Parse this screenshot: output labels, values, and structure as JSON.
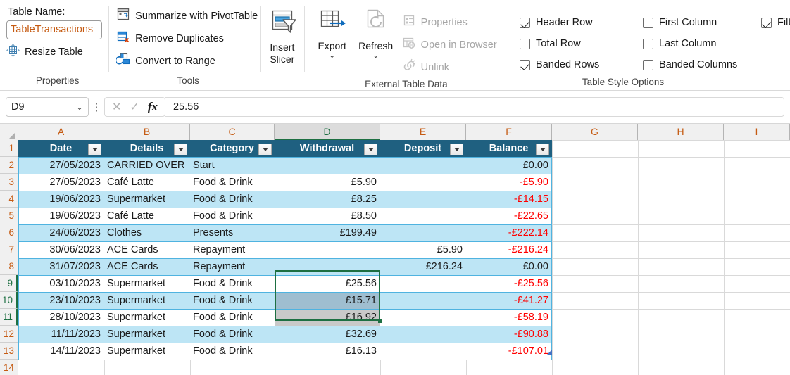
{
  "ribbon": {
    "properties": {
      "group_label": "Properties",
      "table_name_label": "Table Name:",
      "table_name_value": "TableTransactions",
      "resize_table": "Resize Table"
    },
    "tools": {
      "group_label": "Tools",
      "summarize": "Summarize with PivotTable",
      "remove_duplicates": "Remove Duplicates",
      "convert_to_range": "Convert to Range"
    },
    "slicer": {
      "insert_slicer_line1": "Insert",
      "insert_slicer_line2": "Slicer"
    },
    "external": {
      "group_label": "External Table Data",
      "export": "Export",
      "refresh": "Refresh",
      "properties": "Properties",
      "open_in_browser": "Open in Browser",
      "unlink": "Unlink",
      "chevron": "⌄"
    },
    "table_style_options": {
      "group_label": "Table Style Options",
      "items": [
        {
          "label": "Header Row",
          "checked": true
        },
        {
          "label": "Total Row",
          "checked": false
        },
        {
          "label": "Banded Rows",
          "checked": true
        },
        {
          "label": "First Column",
          "checked": false
        },
        {
          "label": "Last Column",
          "checked": false
        },
        {
          "label": "Banded Columns",
          "checked": false
        },
        {
          "label": "Filter Button",
          "checked": true
        }
      ]
    }
  },
  "formula_bar": {
    "name_box_value": "D9",
    "name_box_chevron": "⌄",
    "more_dots": "⋮",
    "cancel_icon": "✕",
    "confirm_icon": "✓",
    "fx_label": "fx",
    "formula_value": "25.56"
  },
  "grid": {
    "columns": [
      "A",
      "B",
      "C",
      "D",
      "E",
      "F",
      "G",
      "H",
      "I"
    ],
    "active_column": "D",
    "rows": [
      "1",
      "2",
      "3",
      "4",
      "5",
      "6",
      "7",
      "8",
      "9",
      "10",
      "11",
      "12",
      "13",
      "14"
    ],
    "active_rows": [
      "9",
      "10",
      "11"
    ],
    "active_cell": "D9",
    "selection_range": "D9:D11",
    "header_row": [
      "Date",
      "Details",
      "Category",
      "Withdrawal",
      "Deposit",
      "Balance"
    ],
    "data": [
      {
        "date": "27/05/2023",
        "details": "CARRIED OVER",
        "category": "Start",
        "withdrawal": "",
        "deposit": "",
        "balance": "£0.00",
        "negative": false
      },
      {
        "date": "27/05/2023",
        "details": "Café Latte",
        "category": "Food & Drink",
        "withdrawal": "£5.90",
        "deposit": "",
        "balance": "-£5.90",
        "negative": true
      },
      {
        "date": "19/06/2023",
        "details": "Supermarket",
        "category": "Food & Drink",
        "withdrawal": "£8.25",
        "deposit": "",
        "balance": "-£14.15",
        "negative": true
      },
      {
        "date": "19/06/2023",
        "details": "Café Latte",
        "category": "Food & Drink",
        "withdrawal": "£8.50",
        "deposit": "",
        "balance": "-£22.65",
        "negative": true
      },
      {
        "date": "24/06/2023",
        "details": "Clothes",
        "category": "Presents",
        "withdrawal": "£199.49",
        "deposit": "",
        "balance": "-£222.14",
        "negative": true
      },
      {
        "date": "30/06/2023",
        "details": "ACE Cards",
        "category": "Repayment",
        "withdrawal": "",
        "deposit": "£5.90",
        "balance": "-£216.24",
        "negative": true
      },
      {
        "date": "31/07/2023",
        "details": "ACE Cards",
        "category": "Repayment",
        "withdrawal": "",
        "deposit": "£216.24",
        "balance": "£0.00",
        "negative": false
      },
      {
        "date": "03/10/2023",
        "details": "Supermarket",
        "category": "Food & Drink",
        "withdrawal": "£25.56",
        "deposit": "",
        "balance": "-£25.56",
        "negative": true
      },
      {
        "date": "23/10/2023",
        "details": "Supermarket",
        "category": "Food & Drink",
        "withdrawal": "£15.71",
        "deposit": "",
        "balance": "-£41.27",
        "negative": true
      },
      {
        "date": "28/10/2023",
        "details": "Supermarket",
        "category": "Food & Drink",
        "withdrawal": "£16.92",
        "deposit": "",
        "balance": "-£58.19",
        "negative": true
      },
      {
        "date": "11/11/2023",
        "details": "Supermarket",
        "category": "Food & Drink",
        "withdrawal": "£32.69",
        "deposit": "",
        "balance": "-£90.88",
        "negative": true
      },
      {
        "date": "14/11/2023",
        "details": "Supermarket",
        "category": "Food & Drink",
        "withdrawal": "£16.13",
        "deposit": "",
        "balance": "-£107.01",
        "negative": true
      }
    ]
  },
  "colors": {
    "table_header_bg": "#1f6080",
    "banded_row_bg": "#bde5f5",
    "selection_border": "#1d6f42",
    "negative_text": "#ff0000",
    "column_letter": "#c55a11",
    "table_border": "#4fb3e0",
    "table_resize_handle": "#4472c4"
  }
}
